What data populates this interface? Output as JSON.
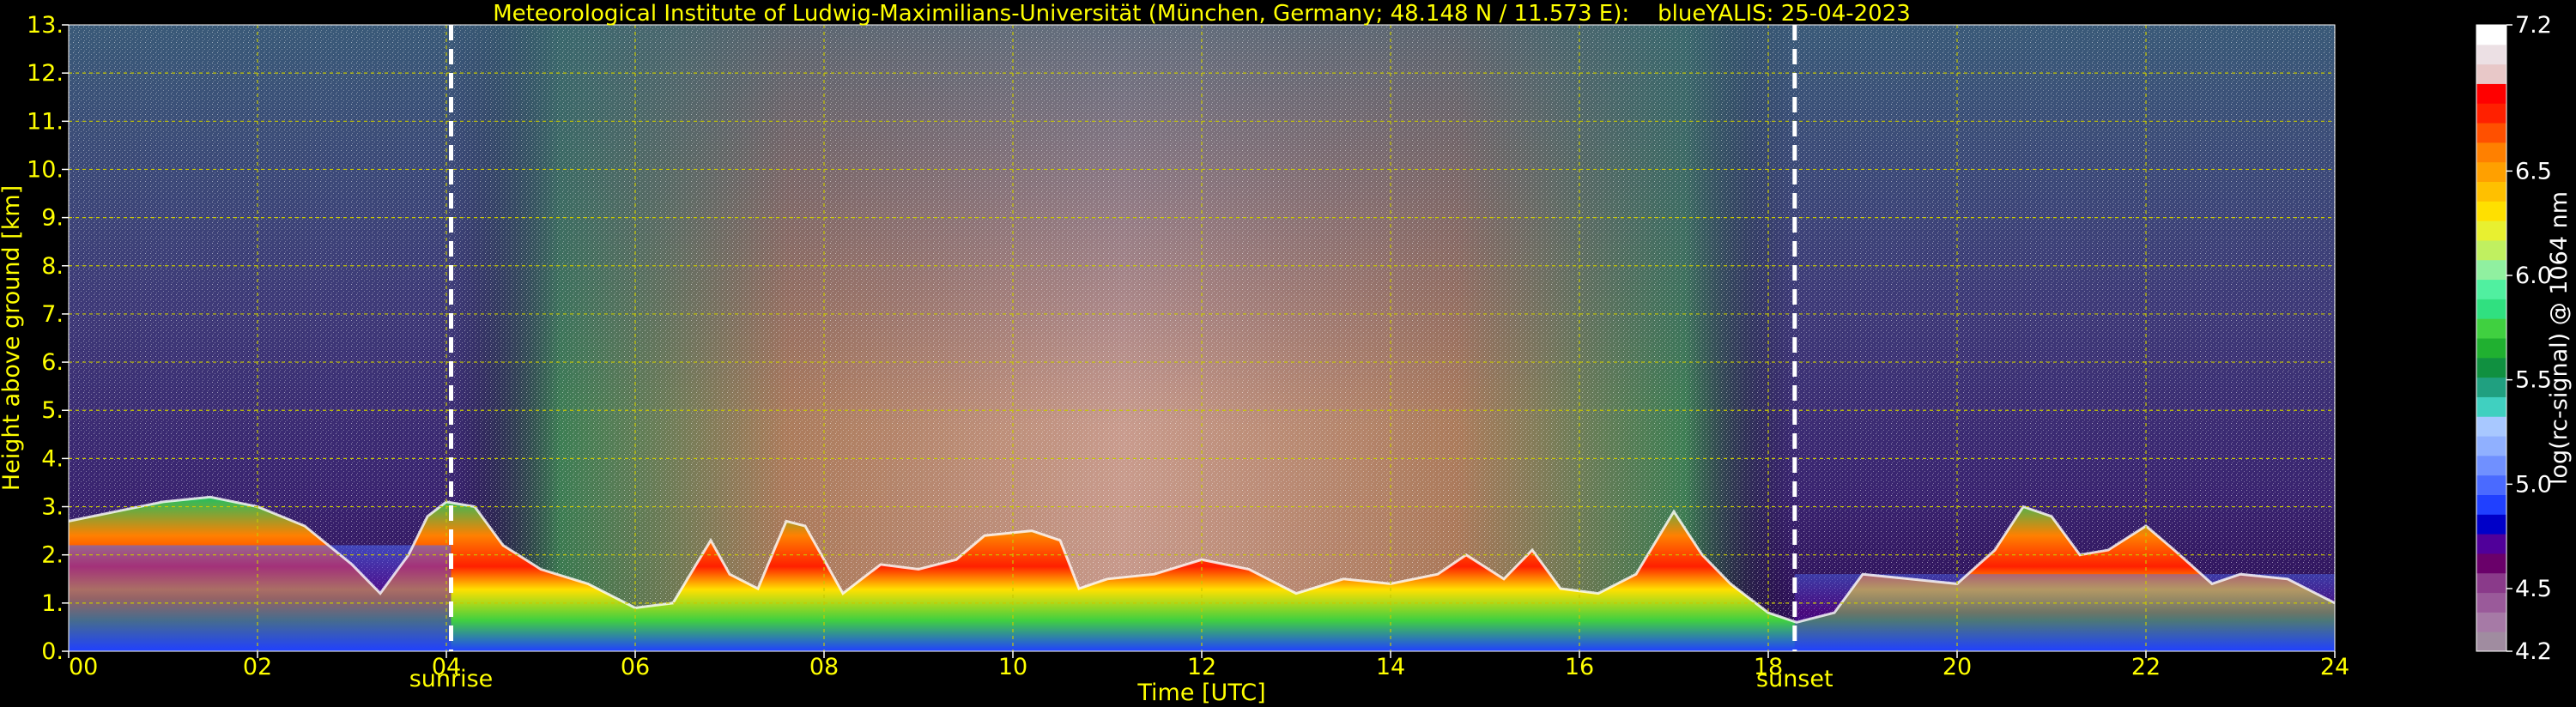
{
  "chart_data": {
    "type": "heatmap",
    "title": "Meteorological Institute of Ludwig-Maximilians-Universität (München, Germany; 48.148 N / 11.573 E):    blueYALIS: 25-04-2023",
    "xlabel": "Time [UTC]",
    "ylabel": "Height above ground [km]",
    "xlim": [
      0,
      24
    ],
    "ylim": [
      0,
      13
    ],
    "x_ticks": [
      "00",
      "02",
      "04",
      "06",
      "08",
      "10",
      "12",
      "14",
      "16",
      "18",
      "20",
      "22",
      "24"
    ],
    "y_ticks": [
      "0.",
      "1.",
      "2.",
      "3.",
      "4.",
      "5.",
      "6.",
      "7.",
      "8.",
      "9.",
      "10.",
      "11.",
      "12.",
      "13."
    ],
    "grid": true,
    "markers": [
      {
        "label": "sunrise",
        "time": 4.05
      },
      {
        "label": "sunset",
        "time": 18.28
      }
    ],
    "colorbar": {
      "label": "log(rc-signal) @ 1064 nm",
      "range": [
        4.2,
        7.2
      ],
      "tick_labels": [
        "7.2",
        "6.5",
        "6.0",
        "5.5",
        "5.0",
        "4.5",
        "4.2"
      ],
      "tick_values": [
        7.2,
        6.5,
        6.0,
        5.5,
        5.0,
        4.5,
        4.2
      ],
      "colors": [
        "#a08ca0",
        "#a67aa6",
        "#9a5a9a",
        "#8a3a8a",
        "#6a006a",
        "#50009a",
        "#0000c8",
        "#2040ff",
        "#4a6aff",
        "#7090ff",
        "#90b0ff",
        "#a8c8ff",
        "#40d0c0",
        "#20a080",
        "#109040",
        "#20b030",
        "#40d040",
        "#30e080",
        "#50f0a0",
        "#90f0a0",
        "#c0f060",
        "#e8f030",
        "#ffe000",
        "#ffc000",
        "#ffa000",
        "#ff8000",
        "#ff5000",
        "#ff2000",
        "#ff0000",
        "#e8c8c8",
        "#ece0e4",
        "#ffffff"
      ]
    },
    "boundary_layer_top_km": [
      [
        0,
        2.7
      ],
      [
        0.5,
        2.9
      ],
      [
        1,
        3.1
      ],
      [
        1.5,
        3.2
      ],
      [
        2,
        3.0
      ],
      [
        2.5,
        2.6
      ],
      [
        3,
        1.8
      ],
      [
        3.3,
        1.2
      ],
      [
        3.6,
        2.0
      ],
      [
        3.8,
        2.8
      ],
      [
        4,
        3.1
      ],
      [
        4.3,
        3.0
      ],
      [
        4.6,
        2.2
      ],
      [
        5,
        1.7
      ],
      [
        5.5,
        1.4
      ],
      [
        6,
        0.9
      ],
      [
        6.4,
        1.0
      ],
      [
        6.8,
        2.3
      ],
      [
        7,
        1.6
      ],
      [
        7.3,
        1.3
      ],
      [
        7.6,
        2.7
      ],
      [
        7.8,
        2.6
      ],
      [
        8.2,
        1.2
      ],
      [
        8.6,
        1.8
      ],
      [
        9,
        1.7
      ],
      [
        9.4,
        1.9
      ],
      [
        9.7,
        2.4
      ],
      [
        10.2,
        2.5
      ],
      [
        10.5,
        2.3
      ],
      [
        10.7,
        1.3
      ],
      [
        11,
        1.5
      ],
      [
        11.5,
        1.6
      ],
      [
        12,
        1.9
      ],
      [
        12.5,
        1.7
      ],
      [
        13,
        1.2
      ],
      [
        13.5,
        1.5
      ],
      [
        14,
        1.4
      ],
      [
        14.5,
        1.6
      ],
      [
        14.8,
        2.0
      ],
      [
        15.2,
        1.5
      ],
      [
        15.5,
        2.1
      ],
      [
        15.8,
        1.3
      ],
      [
        16.2,
        1.2
      ],
      [
        16.6,
        1.6
      ],
      [
        17,
        2.9
      ],
      [
        17.3,
        2.0
      ],
      [
        17.6,
        1.4
      ],
      [
        18,
        0.8
      ],
      [
        18.3,
        0.6
      ],
      [
        18.7,
        0.8
      ],
      [
        19,
        1.6
      ],
      [
        19.5,
        1.5
      ],
      [
        20,
        1.4
      ],
      [
        20.4,
        2.1
      ],
      [
        20.7,
        3.0
      ],
      [
        21,
        2.8
      ],
      [
        21.3,
        2.0
      ],
      [
        21.6,
        2.1
      ],
      [
        22,
        2.6
      ],
      [
        22.3,
        2.1
      ],
      [
        22.7,
        1.4
      ],
      [
        23,
        1.6
      ],
      [
        23.5,
        1.5
      ],
      [
        24,
        1.0
      ]
    ]
  }
}
